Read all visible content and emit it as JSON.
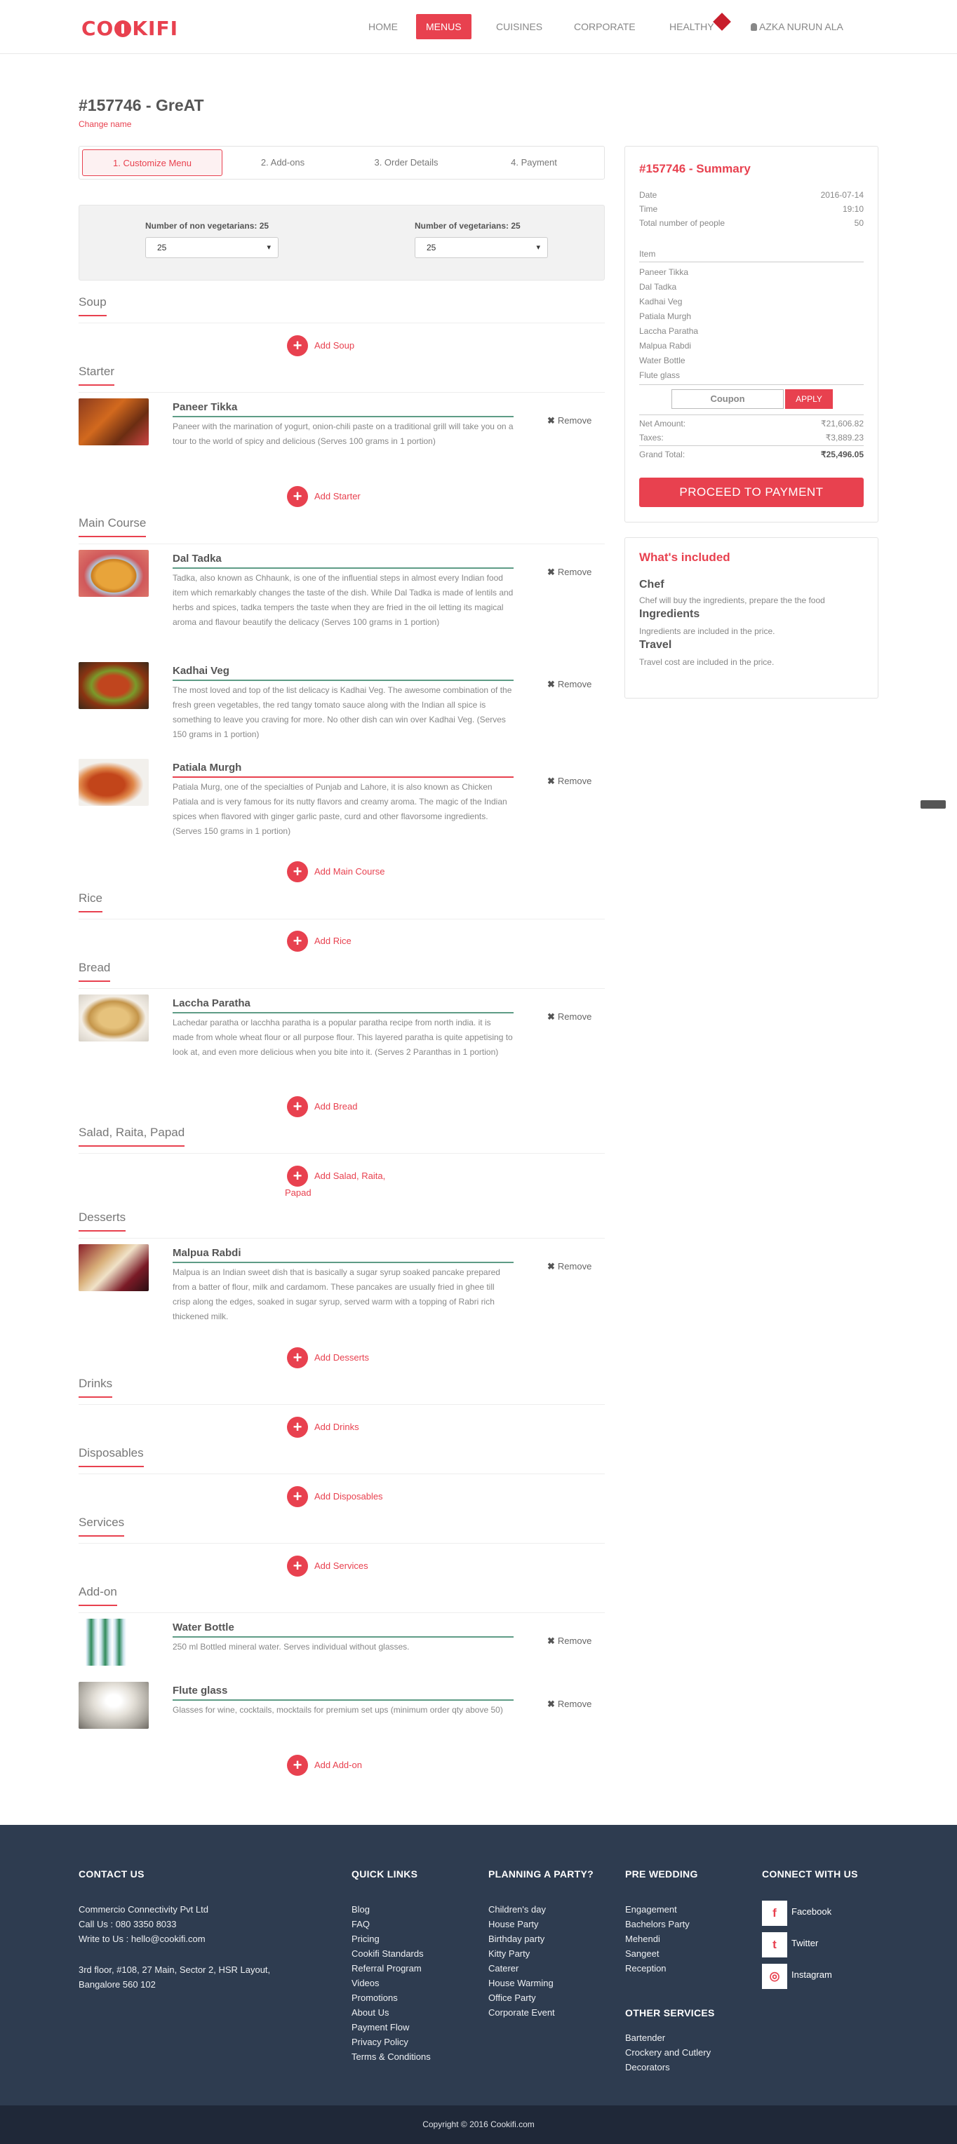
{
  "header": {
    "logo": "COOKIFI",
    "nav": [
      "HOME",
      "MENUS",
      "CUISINES",
      "CORPORATE",
      "HEALTHY"
    ],
    "active_nav": "MENUS",
    "user": "AZKA NURUN ALA"
  },
  "order": {
    "title": "#157746 - GreAT",
    "change_name": "Change name"
  },
  "steps": [
    "1. Customize Menu",
    "2. Add-ons",
    "3. Order Details",
    "4. Payment"
  ],
  "guests": {
    "non_veg_label": "Number of non vegetarians: 25",
    "non_veg_value": "25",
    "veg_label": "Number of vegetarians: 25",
    "veg_value": "25"
  },
  "sections": {
    "soup": {
      "title": "Soup",
      "add": "Add Soup"
    },
    "starter": {
      "title": "Starter",
      "add": "Add Starter"
    },
    "main": {
      "title": "Main Course",
      "add": "Add Main Course"
    },
    "rice": {
      "title": "Rice",
      "add": "Add Rice"
    },
    "bread": {
      "title": "Bread",
      "add": "Add Bread"
    },
    "salad": {
      "title": "Salad, Raita, Papad",
      "add_line1": "Add Salad, Raita,",
      "add_line2": "Papad"
    },
    "desserts": {
      "title": "Desserts",
      "add": "Add Desserts"
    },
    "drinks": {
      "title": "Drinks",
      "add": "Add Drinks"
    },
    "disposables": {
      "title": "Disposables",
      "add": "Add Disposables"
    },
    "services": {
      "title": "Services",
      "add": "Add Services"
    },
    "addon": {
      "title": "Add-on",
      "add": "Add Add-on"
    }
  },
  "remove_label": "Remove",
  "dishes": [
    {
      "name": "Paneer Tikka",
      "desc": "Paneer with the marination of yogurt, onion-chili paste on a traditional grill will take you on a tour to the world of spicy and delicious (Serves 100 grams in 1 portion)"
    },
    {
      "name": "Dal Tadka",
      "desc": "Tadka, also known as Chhaunk, is one of the influential steps in almost every Indian food item which remarkably changes the taste of the dish. While Dal Tadka is made of lentils and herbs and spices, tadka tempers the taste when they are fried in the oil letting its magical aroma and flavour beautify the delicacy (Serves 100 grams in 1 portion)"
    },
    {
      "name": "Kadhai Veg",
      "desc": "The most loved and top of the list delicacy is Kadhai Veg. The awesome combination of the fresh green vegetables, the red tangy tomato sauce along with the Indian all spice is something to leave you craving for more. No other dish can win over Kadhai Veg. (Serves 150 grams in 1 portion)"
    },
    {
      "name": "Patiala Murgh",
      "desc": "Patiala Murg, one of the specialties of Punjab and Lahore, it is also known as Chicken Patiala and is very famous for its nutty flavors and creamy aroma. The magic of the Indian spices when flavored with ginger garlic paste, curd and other flavorsome ingredients. (Serves 150 grams in 1 portion)"
    },
    {
      "name": "Laccha Paratha",
      "desc": "Lachedar paratha or lacchha paratha is a popular paratha recipe from north india. it is made from whole wheat flour or all purpose flour. This layered paratha is quite appetising to look at, and even more delicious when you bite into it. (Serves 2 Paranthas in 1 portion)"
    },
    {
      "name": "Malpua Rabdi",
      "desc": "Malpua is an Indian sweet dish that is basically a sugar syrup soaked pancake prepared from a batter of flour, milk and cardamom. These pancakes are usually fried in ghee till crisp along the edges, soaked in sugar syrup, served warm with a topping of Rabri rich thickened milk."
    },
    {
      "name": "Water Bottle",
      "desc": "250 ml Bottled mineral water. Serves individual without glasses."
    },
    {
      "name": "Flute glass",
      "desc": "Glasses for wine, cocktails, mocktails for premium set ups (minimum order qty above 50)"
    }
  ],
  "summary": {
    "title": "#157746 - Summary",
    "date_label": "Date",
    "date": "2016-07-14",
    "time_label": "Time",
    "time": "19:10",
    "people_label": "Total number of people",
    "people": "50",
    "item_label": "Item",
    "items": [
      "Paneer Tikka",
      "Dal Tadka",
      "Kadhai Veg",
      "Patiala Murgh",
      "Laccha Paratha",
      "Malpua Rabdi",
      "Water Bottle",
      "Flute glass"
    ],
    "coupon_placeholder": "Coupon",
    "apply": "APPLY",
    "net_label": "Net Amount:",
    "net": "₹21,606.82",
    "tax_label": "Taxes:",
    "tax": "₹3,889.23",
    "grand_label": "Grand Total:",
    "grand": "₹25,496.05",
    "proceed": "PROCEED TO PAYMENT"
  },
  "included": {
    "title": "What's included",
    "items": [
      {
        "head": "Chef",
        "text": "Chef will buy the ingredients, prepare the the food"
      },
      {
        "head": "Ingredients",
        "text": "Ingredients are included in the price."
      },
      {
        "head": "Travel",
        "text": "Travel cost are included in the price."
      }
    ]
  },
  "footer": {
    "contact_title": "CONTACT US",
    "company": "Commercio Connectivity Pvt Ltd",
    "call": "Call Us : 080 3350 8033",
    "write": "Write to Us : hello@cookifi.com",
    "address1": "3rd floor, #108, 27 Main, Sector 2, HSR Layout,",
    "address2": "Bangalore 560 102",
    "quick_title": "QUICK LINKS",
    "quick_links": [
      "Blog",
      "FAQ",
      "Pricing",
      "Cookifi Standards",
      "Referral Program",
      "Videos",
      "Promotions",
      "About Us",
      "Payment Flow",
      "Privacy Policy",
      "Terms & Conditions"
    ],
    "party_title": "PLANNING A PARTY?",
    "party_links": [
      "Children's day",
      "House Party",
      "Birthday party",
      "Kitty Party",
      "Caterer",
      "House Warming",
      "Office Party",
      "Corporate Event"
    ],
    "wedding_title": "PRE WEDDING",
    "wedding_links": [
      "Engagement",
      "Bachelors Party",
      "Mehendi",
      "Sangeet",
      "Reception"
    ],
    "other_title": "OTHER SERVICES",
    "other_links": [
      "Bartender",
      "Crockery and Cutlery",
      "Decorators"
    ],
    "connect_title": "CONNECT WITH US",
    "social": [
      {
        "label": "Facebook",
        "glyph": "f"
      },
      {
        "label": "Twitter",
        "glyph": "t"
      },
      {
        "label": "Instagram",
        "glyph": "◎"
      }
    ],
    "copyright": "Copyright © 2016 Cookifi.com"
  },
  "colors": {
    "accent": "#e8414f",
    "footer_bg": "#2e3c50",
    "copy_bg": "#1f2838",
    "desc_line": "#5e9c86"
  }
}
